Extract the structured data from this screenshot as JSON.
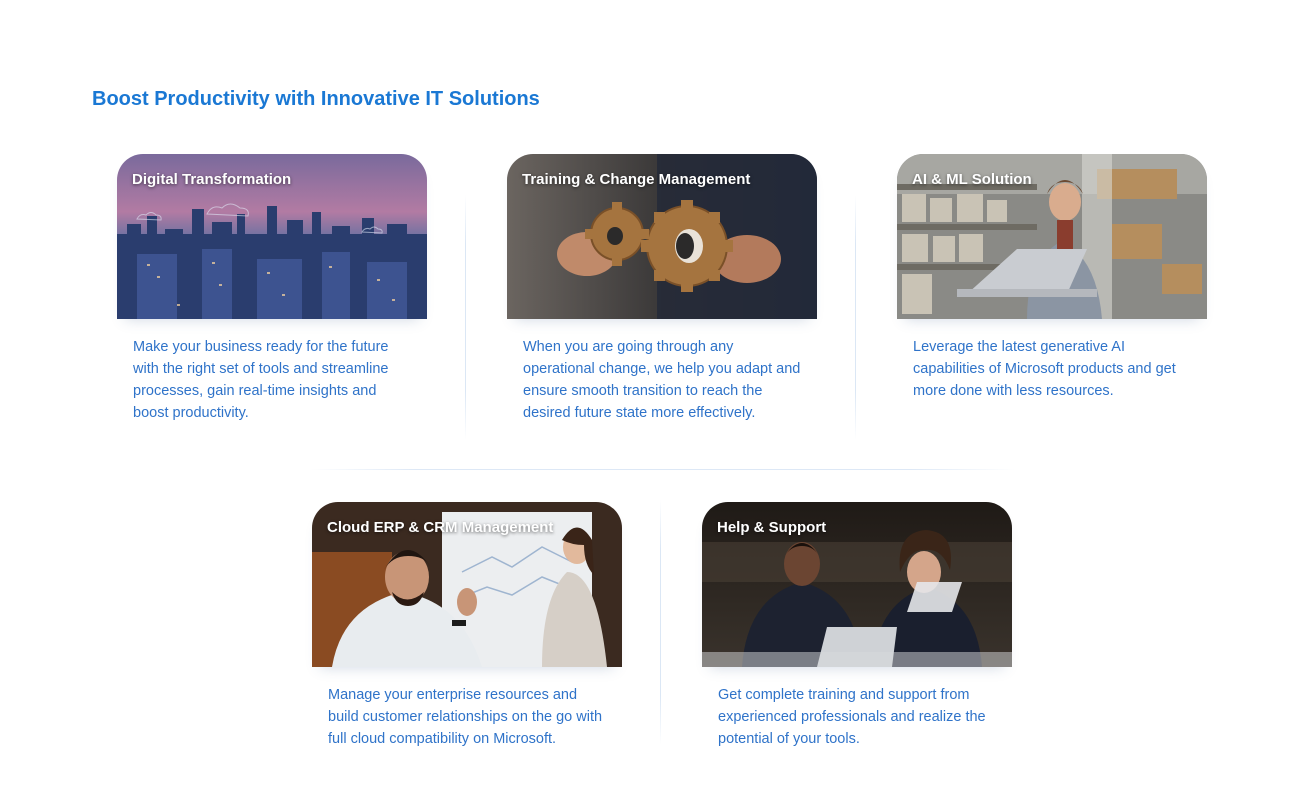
{
  "section": {
    "title": "Boost Productivity with Innovative IT Solutions"
  },
  "cards": [
    {
      "title": "Digital Transformation",
      "description": "Make your business ready for the future with the right set of tools and streamline processes, gain real-time insights and boost productivity.",
      "image": "city-skyline-image"
    },
    {
      "title": "Training & Change Management",
      "description": "When you are going through any operational change, we help you adapt and ensure smooth transition to reach the desired future state more effectively.",
      "image": "gears-image"
    },
    {
      "title": "AI & ML Solution",
      "description": "Leverage the latest generative AI capabilities of Microsoft products and get more done with less resources.",
      "image": "warehouse-laptop-image"
    },
    {
      "title": "Cloud ERP & CRM Management",
      "description": "Manage your enterprise resources and build customer relationships on the go with full cloud compatibility on Microsoft.",
      "image": "office-whiteboard-image"
    },
    {
      "title": "Help & Support",
      "description": "Get complete training and support from experienced professionals and realize the potential of your tools.",
      "image": "meeting-laptop-image"
    }
  ]
}
